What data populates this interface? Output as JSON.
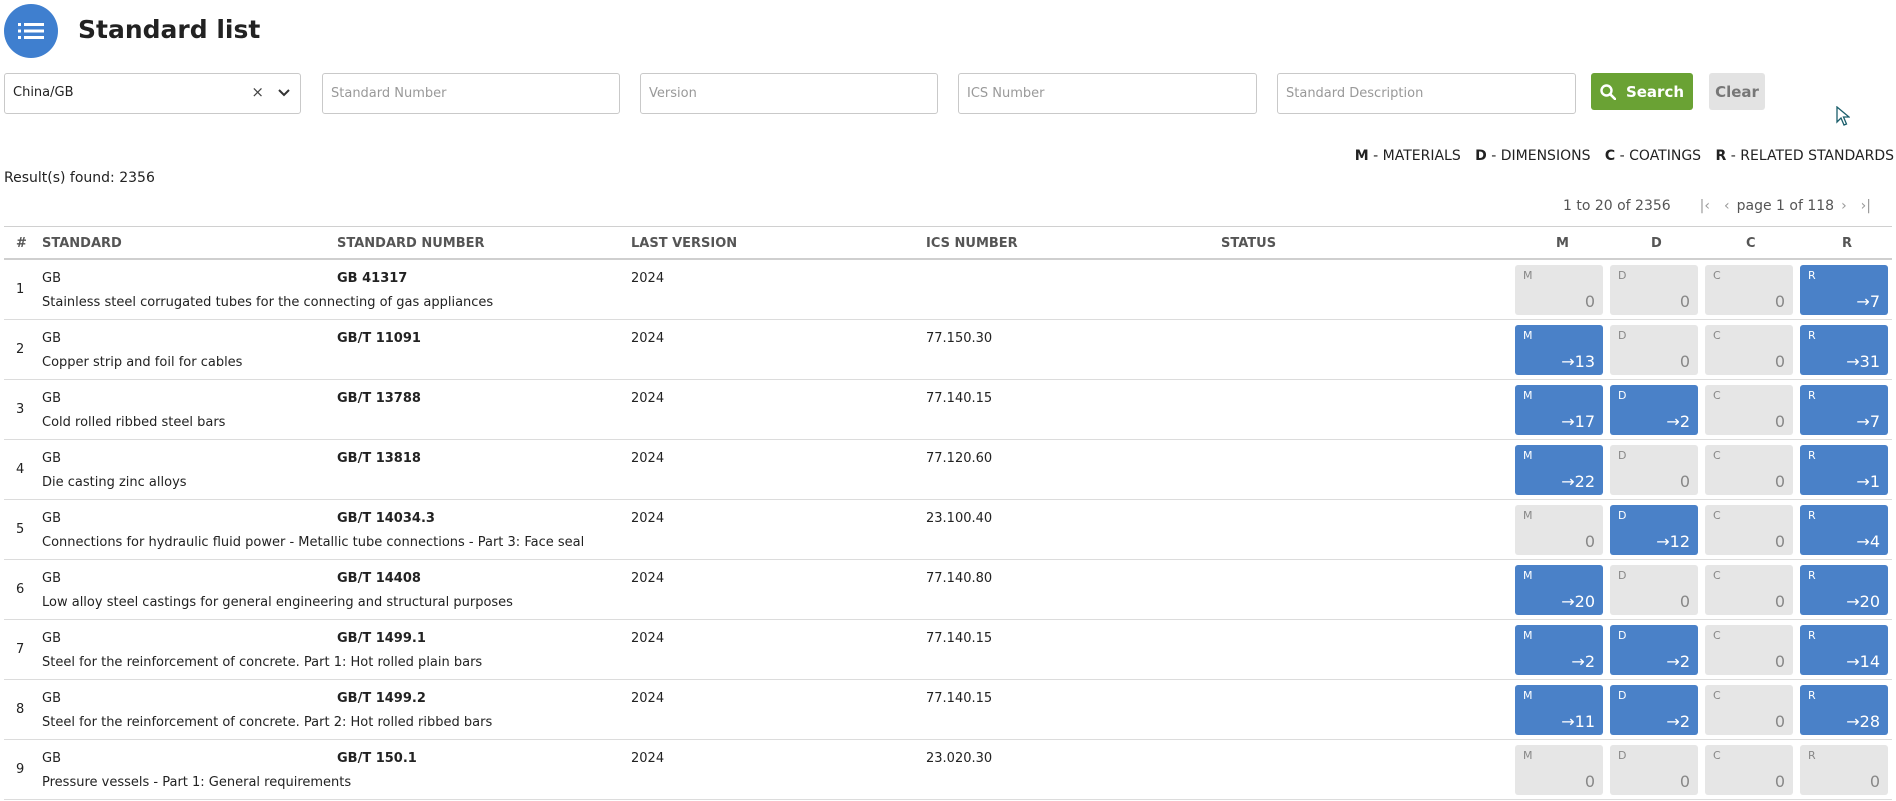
{
  "header": {
    "title": "Standard list",
    "menu_icon": "list-icon"
  },
  "filters": {
    "country_value": "China/GB",
    "standard_number_placeholder": "Standard Number",
    "version_placeholder": "Version",
    "ics_number_placeholder": "ICS Number",
    "description_placeholder": "Standard Description",
    "search_label": "Search",
    "clear_label": "Clear"
  },
  "legend": {
    "m_key": "M",
    "m_text": "- MATERIALS",
    "d_key": "D",
    "d_text": "- DIMENSIONS",
    "c_key": "C",
    "c_text": "- COATINGS",
    "r_key": "R",
    "r_text": "- RELATED STANDARDS"
  },
  "results": {
    "label": "Result(s) found: 2356"
  },
  "pagination": {
    "range": "1 to  20 of  2356",
    "page": "page 1 of  118"
  },
  "table": {
    "headers": {
      "idx": "#",
      "standard": "STANDARD",
      "number": "STANDARD NUMBER",
      "version": "LAST VERSION",
      "ics": "ICS NUMBER",
      "status": "STATUS",
      "m": "M",
      "d": "D",
      "c": "C",
      "r": "R"
    },
    "rows": [
      {
        "idx": "1",
        "std": "GB",
        "num": "GB 41317",
        "ver": "2024",
        "ics": "",
        "status": "",
        "desc": "Stainless steel corrugated tubes for the connecting of gas appliances",
        "m": "0",
        "d": "0",
        "c": "0",
        "r": "→7"
      },
      {
        "idx": "2",
        "std": "GB",
        "num": "GB/T 11091",
        "ver": "2024",
        "ics": "77.150.30",
        "status": "",
        "desc": "Copper strip and foil for cables",
        "m": "→13",
        "d": "0",
        "c": "0",
        "r": "→31"
      },
      {
        "idx": "3",
        "std": "GB",
        "num": "GB/T 13788",
        "ver": "2024",
        "ics": "77.140.15",
        "status": "",
        "desc": "Cold rolled ribbed steel bars",
        "m": "→17",
        "d": "→2",
        "c": "0",
        "r": "→7"
      },
      {
        "idx": "4",
        "std": "GB",
        "num": "GB/T 13818",
        "ver": "2024",
        "ics": "77.120.60",
        "status": "",
        "desc": "Die casting zinc alloys",
        "m": "→22",
        "d": "0",
        "c": "0",
        "r": "→1"
      },
      {
        "idx": "5",
        "std": "GB",
        "num": "GB/T 14034.3",
        "ver": "2024",
        "ics": "23.100.40",
        "status": "",
        "desc": "Connections for hydraulic fluid power - Metallic tube connections - Part 3: Face seal",
        "m": "0",
        "d": "→12",
        "c": "0",
        "r": "→4"
      },
      {
        "idx": "6",
        "std": "GB",
        "num": "GB/T 14408",
        "ver": "2024",
        "ics": "77.140.80",
        "status": "",
        "desc": "Low alloy steel castings for general engineering and structural purposes",
        "m": "→20",
        "d": "0",
        "c": "0",
        "r": "→20"
      },
      {
        "idx": "7",
        "std": "GB",
        "num": "GB/T 1499.1",
        "ver": "2024",
        "ics": "77.140.15",
        "status": "",
        "desc": "Steel for the reinforcement of concrete. Part 1: Hot rolled plain bars",
        "m": "→2",
        "d": "→2",
        "c": "0",
        "r": "→14"
      },
      {
        "idx": "8",
        "std": "GB",
        "num": "GB/T 1499.2",
        "ver": "2024",
        "ics": "77.140.15",
        "status": "",
        "desc": "Steel for the reinforcement of concrete. Part 2: Hot rolled ribbed bars",
        "m": "→11",
        "d": "→2",
        "c": "0",
        "r": "→28"
      },
      {
        "idx": "9",
        "std": "GB",
        "num": "GB/T 150.1",
        "ver": "2024",
        "ics": "23.020.30",
        "status": "",
        "desc": "Pressure vessels - Part 1: General requirements",
        "m": "0",
        "d": "0",
        "c": "0",
        "r": "0"
      }
    ]
  },
  "colors": {
    "accent": "#4a81c8",
    "search_green": "#6aa234",
    "inactive_box": "#e6e6e6"
  }
}
